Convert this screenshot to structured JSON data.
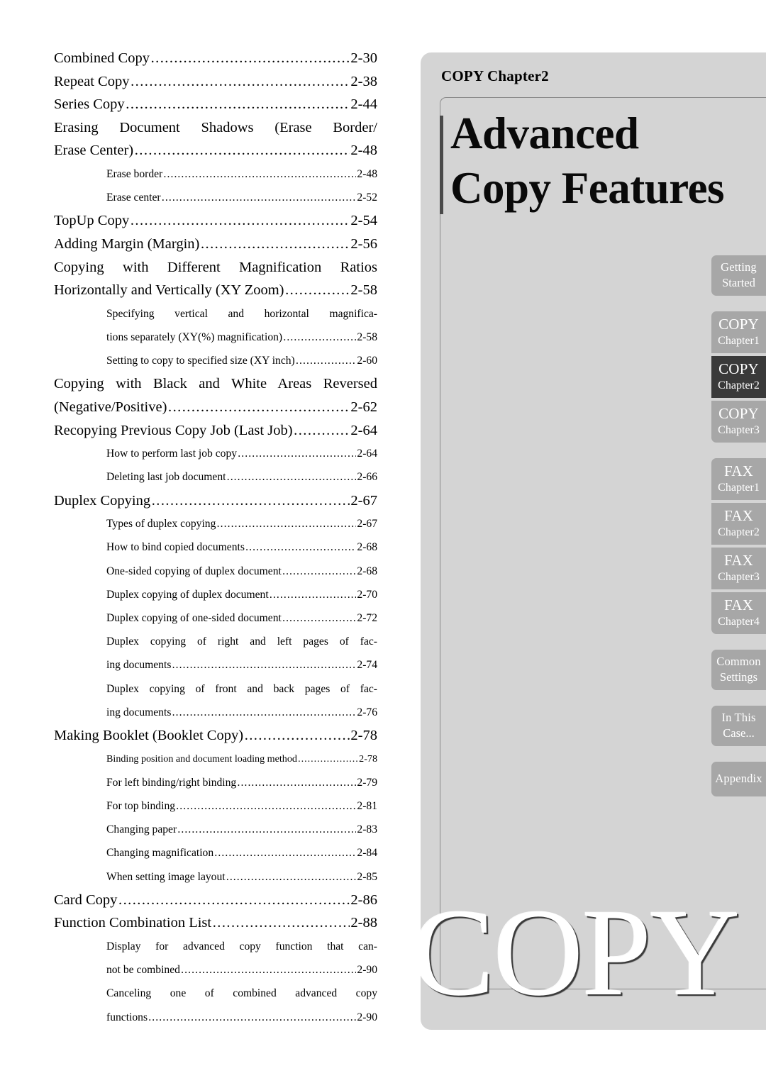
{
  "toc": {
    "entries": [
      {
        "level": 1,
        "label": "Combined Copy",
        "page": "2-30"
      },
      {
        "level": 1,
        "label": "Repeat Copy",
        "page": "2-38"
      },
      {
        "level": 1,
        "label": "Series Copy",
        "page": "2-44"
      },
      {
        "level": 1,
        "label": "Erasing Document Shadows (Erase Border/",
        "label2": "Erase Center)",
        "page": "2-48"
      },
      {
        "level": 2,
        "label": "Erase border",
        "page": "2-48"
      },
      {
        "level": 2,
        "label": "Erase center",
        "page": "2-52"
      },
      {
        "level": 1,
        "label": "TopUp Copy",
        "page": "2-54"
      },
      {
        "level": 1,
        "label": "Adding Margin (Margin)",
        "page": "2-56"
      },
      {
        "level": 1,
        "label": "Copying with Different Magnification Ratios",
        "label2": "Horizontally and Vertically (XY Zoom)",
        "page": "2-58"
      },
      {
        "level": 2,
        "label": "Specifying vertical and horizontal magnifica-",
        "label2": "tions separately (XY(%) magnification)",
        "page": "2-58"
      },
      {
        "level": 2,
        "label": "Setting to copy to specified size (XY inch)",
        "page": "2-60"
      },
      {
        "level": 1,
        "label": "Copying with Black and White Areas Reversed",
        "label2": "(Negative/Positive)",
        "page": "2-62"
      },
      {
        "level": 1,
        "label": "Recopying Previous Copy Job (Last Job)",
        "page": "2-64"
      },
      {
        "level": 2,
        "label": "How to perform last job copy",
        "page": "2-64"
      },
      {
        "level": 2,
        "label": "Deleting last job document",
        "page": "2-66"
      },
      {
        "level": 1,
        "label": "Duplex Copying",
        "page": "2-67"
      },
      {
        "level": 2,
        "label": "Types of duplex copying",
        "page": "2-67"
      },
      {
        "level": 2,
        "label": "How to bind copied documents",
        "page": "2-68"
      },
      {
        "level": 2,
        "label": "One-sided copying of duplex document",
        "page": "2-68"
      },
      {
        "level": 2,
        "label": "Duplex copying of duplex document",
        "page": "2-70"
      },
      {
        "level": 2,
        "label": "Duplex copying of one-sided document",
        "page": "2-72"
      },
      {
        "level": 2,
        "label": "Duplex copying of right and left pages of fac-",
        "label2": "ing documents",
        "page": "2-74"
      },
      {
        "level": 2,
        "label": "Duplex copying of front and back pages of fac-",
        "label2": "ing documents",
        "page": "2-76"
      },
      {
        "level": 1,
        "label": "Making Booklet (Booklet Copy)",
        "page": "2-78"
      },
      {
        "level": 2,
        "tight": true,
        "label": "Binding position and document loading method",
        "page": "2-78"
      },
      {
        "level": 2,
        "label": "For left binding/right binding",
        "page": "2-79"
      },
      {
        "level": 2,
        "label": "For top binding",
        "page": "2-81"
      },
      {
        "level": 2,
        "label": "Changing paper",
        "page": "2-83"
      },
      {
        "level": 2,
        "label": "Changing magnification",
        "page": "2-84"
      },
      {
        "level": 2,
        "label": "When setting image layout",
        "page": "2-85"
      },
      {
        "level": 1,
        "label": "Card Copy",
        "page": "2-86"
      },
      {
        "level": 1,
        "label": "Function Combination List",
        "page": "2-88"
      },
      {
        "level": 2,
        "label": "Display for advanced copy function that can-",
        "label2": "not be combined",
        "page": "2-90"
      },
      {
        "level": 2,
        "label": "Canceling one of combined advanced copy",
        "label2": "functions",
        "page": "2-90"
      }
    ]
  },
  "panel": {
    "chapter_label": "COPY Chapter2",
    "title_line1": "Advanced",
    "title_line2": "Copy Features",
    "watermark": "COPY",
    "background_color": "#d4d4d4",
    "accent_bar_color": "#4a4a4a"
  },
  "tabs": {
    "inactive_color": "#a7a7a7",
    "active_color": "#3a3a3a",
    "text_color": "#ffffff",
    "groups": [
      {
        "items": [
          {
            "line1": "Getting",
            "line2": "Started",
            "active": false,
            "style": "two-small"
          }
        ]
      },
      {
        "items": [
          {
            "line1": "COPY",
            "line2": "Chapter1",
            "active": false,
            "style": ""
          },
          {
            "line1": "COPY",
            "line2": "Chapter2",
            "active": true,
            "style": ""
          },
          {
            "line1": "COPY",
            "line2": "Chapter3",
            "active": false,
            "style": ""
          }
        ]
      },
      {
        "items": [
          {
            "line1": "FAX",
            "line2": "Chapter1",
            "active": false,
            "style": ""
          },
          {
            "line1": "FAX",
            "line2": "Chapter2",
            "active": false,
            "style": ""
          },
          {
            "line1": "FAX",
            "line2": "Chapter3",
            "active": false,
            "style": ""
          },
          {
            "line1": "FAX",
            "line2": "Chapter4",
            "active": false,
            "style": ""
          }
        ]
      },
      {
        "items": [
          {
            "line1": "Common",
            "line2": "Settings",
            "active": false,
            "style": "two-small"
          }
        ]
      },
      {
        "items": [
          {
            "line1": "In This",
            "line2": "Case...",
            "active": false,
            "style": "two-small"
          }
        ]
      },
      {
        "items": [
          {
            "line1": "Appendix",
            "line2": "",
            "active": false,
            "style": "single"
          }
        ]
      }
    ]
  }
}
